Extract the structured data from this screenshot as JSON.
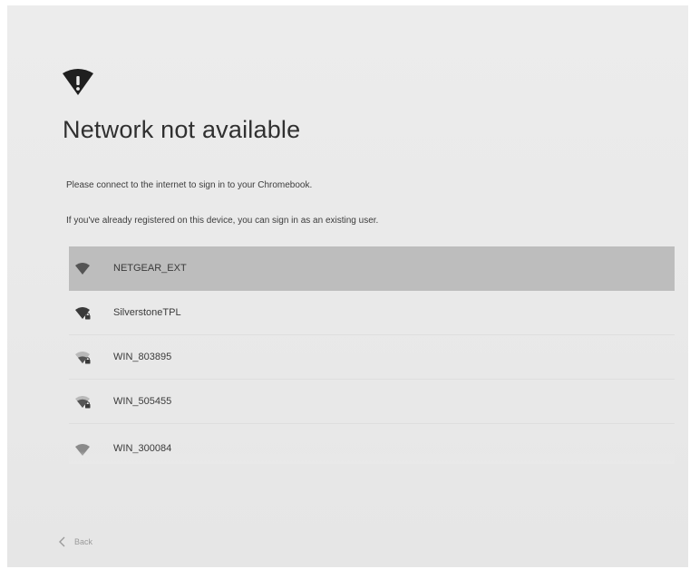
{
  "screen": {
    "title": "Network not available",
    "message_connect": "Please connect to the internet to sign in to your Chromebook.",
    "message_existing_user": "If you've already registered on this device, you can sign in as an existing user."
  },
  "networks": [
    {
      "name": "NETGEAR_EXT",
      "secured": false,
      "selected": true
    },
    {
      "name": "SilverstoneTPL",
      "secured": true,
      "selected": false
    },
    {
      "name": "WIN_803895",
      "secured": true,
      "selected": false
    },
    {
      "name": "WIN_505455",
      "secured": true,
      "selected": false
    },
    {
      "name": "WIN_300084",
      "secured": false,
      "selected": false
    }
  ],
  "navigation": {
    "back_label": "Back"
  },
  "icons": {
    "header": "wifi-offline-icon",
    "network": "wifi-signal-icon",
    "secured_badge": "lock-icon",
    "back": "chevron-left-icon"
  },
  "colors": {
    "background": "#e9e9e9",
    "selected_row": "#bdbdbd",
    "text": "#303030",
    "icon": "#333333"
  }
}
